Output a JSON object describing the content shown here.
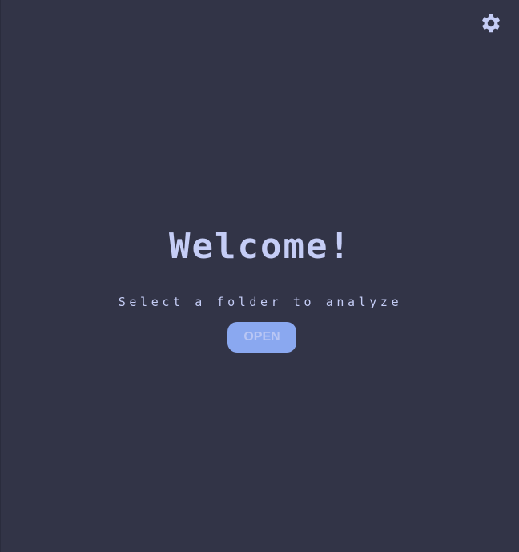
{
  "header": {
    "settings_icon": "gear-icon"
  },
  "welcome": {
    "title": "Welcome!",
    "subtitle": "Select a folder to analyze",
    "open_label": "OPEN"
  },
  "colors": {
    "background": "#323447",
    "text": "#c5cdf6",
    "accent": "#8aa8f0"
  }
}
